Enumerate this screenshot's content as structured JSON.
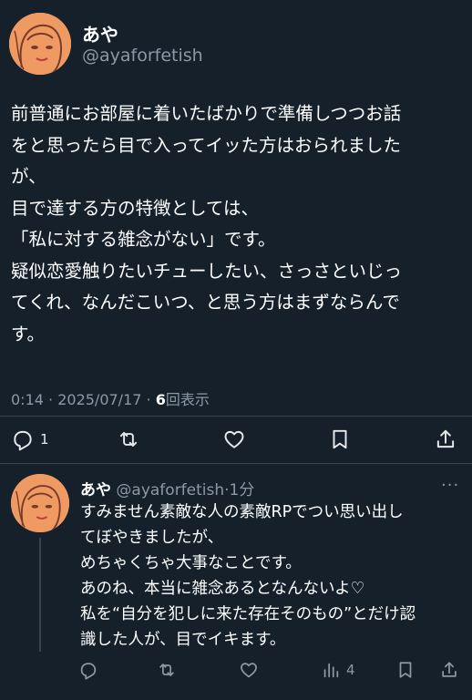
{
  "tweet": {
    "author_name": "あや",
    "author_handle": "@ayaforfetish",
    "body_lines": [
      "前普通にお部屋に着いたばかりで準備しつつお話",
      "をと思ったら目で入ってイッた方はおられました",
      "が、",
      "目で達する方の特徴としては、",
      "「私に対する雑念がない」です。",
      "疑似恋愛触りたいチューしたい、さっさといじっ",
      "てくれ、なんだこいつ、と思う方はまずならんで",
      "す。"
    ],
    "time": "0:14",
    "date": "2025/07/17",
    "views_count": "6",
    "views_label": "回表示",
    "reply_count": "1",
    "icons": [
      "reply-icon",
      "retweet-icon",
      "like-icon",
      "bookmark-icon",
      "share-icon"
    ]
  },
  "reply": {
    "author_name": "あや",
    "author_handle": "@ayaforfetish",
    "time_ago": "1分",
    "more": "···",
    "body_lines": [
      "すみません素敵な人の素敵RPでつい思い出し",
      "てぼやきましたが、",
      "めちゃくちゃ大事なことです。",
      "あのね、本当に雑念あるとなんないよ♡",
      "私を“自分を犯しに来た存在そのもの”とだけ認",
      "識した人が、目でイキます。"
    ],
    "views_count": "4",
    "icons": [
      "reply-icon",
      "retweet-icon",
      "like-icon",
      "views-icon",
      "bookmark-icon",
      "share-icon"
    ]
  },
  "colors": {
    "background": "#15202b",
    "text": "#ffffff",
    "muted": "#8b98a5",
    "divider": "#38444d",
    "avatar": "#ef9a62"
  }
}
